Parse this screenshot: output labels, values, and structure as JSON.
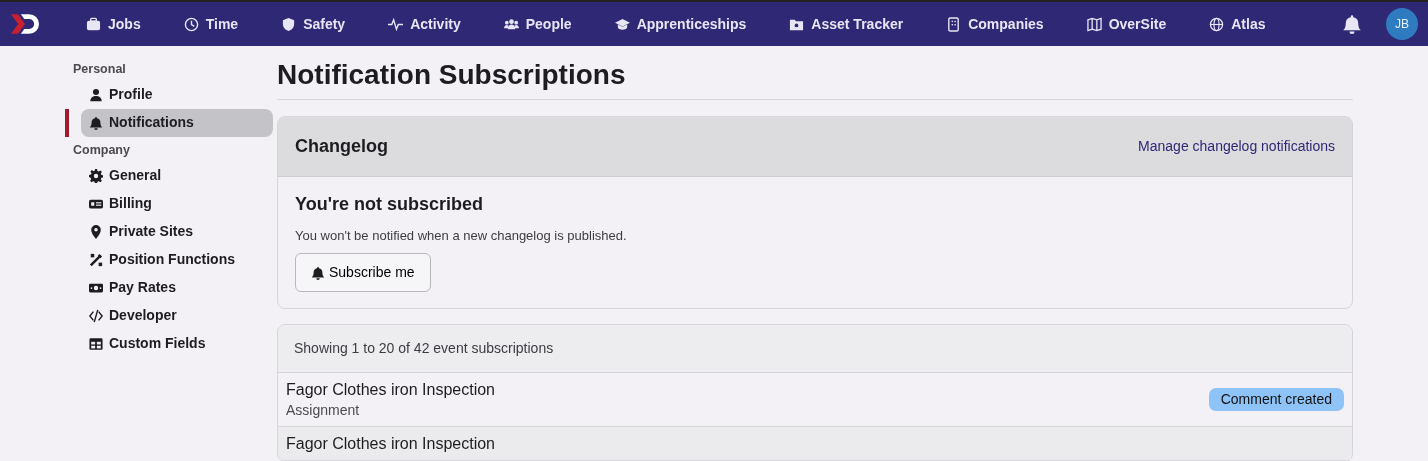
{
  "navbar": {
    "items": [
      {
        "label": "Jobs"
      },
      {
        "label": "Time"
      },
      {
        "label": "Safety"
      },
      {
        "label": "Activity"
      },
      {
        "label": "People"
      },
      {
        "label": "Apprenticeships"
      },
      {
        "label": "Asset Tracker"
      },
      {
        "label": "Companies"
      },
      {
        "label": "OverSite"
      },
      {
        "label": "Atlas"
      }
    ],
    "avatar": "JB"
  },
  "sidebar": {
    "sections": [
      {
        "heading": "Personal",
        "items": [
          {
            "label": "Profile",
            "selected": false
          },
          {
            "label": "Notifications",
            "selected": true
          }
        ]
      },
      {
        "heading": "Company",
        "items": [
          {
            "label": "General",
            "selected": false
          },
          {
            "label": "Billing",
            "selected": false
          },
          {
            "label": "Private Sites",
            "selected": false
          },
          {
            "label": "Position Functions",
            "selected": false
          },
          {
            "label": "Pay Rates",
            "selected": false
          },
          {
            "label": "Developer",
            "selected": false
          },
          {
            "label": "Custom Fields",
            "selected": false
          }
        ]
      }
    ]
  },
  "page_title": "Notification Subscriptions",
  "changelog": {
    "title": "Changelog",
    "link": "Manage changelog notifications",
    "status": "You're not subscribed",
    "description": "You won't be notified when a new changelog is published.",
    "button": "Subscribe me"
  },
  "subscriptions": {
    "summary": "Showing 1 to 20 of 42 event subscriptions",
    "rows": [
      {
        "title": "Fagor Clothes iron Inspection",
        "subtitle": "Assignment",
        "event": "Comment created"
      },
      {
        "title": "Fagor Clothes iron Inspection"
      }
    ]
  }
}
